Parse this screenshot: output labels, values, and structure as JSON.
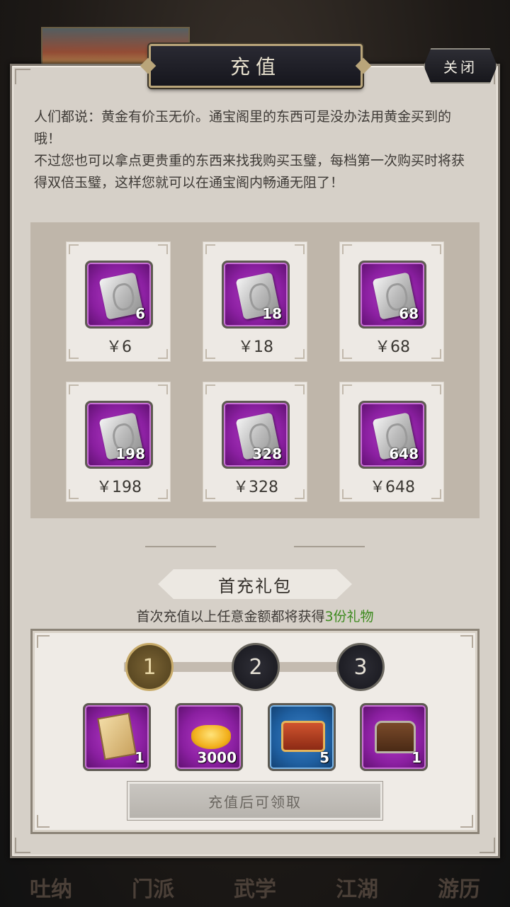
{
  "header": {
    "title": "充值",
    "close_label": "关闭"
  },
  "intro": {
    "line1": "人们都说：黄金有价玉无价。通宝阁里的东西可是没办法用黄金买到的哦！",
    "line2": "不过您也可以拿点更贵重的东西来找我购买玉璧，每档第一次购买时将获得双倍玉璧，这样您就可以在通宝阁内畅通无阻了！"
  },
  "packages": [
    {
      "amount": "6",
      "price": "￥6"
    },
    {
      "amount": "18",
      "price": "￥18"
    },
    {
      "amount": "68",
      "price": "￥68"
    },
    {
      "amount": "198",
      "price": "￥198"
    },
    {
      "amount": "328",
      "price": "￥328"
    },
    {
      "amount": "648",
      "price": "￥648"
    }
  ],
  "first_pack": {
    "title": "首充礼包",
    "desc_prefix": "首次充值以上任意金额都将获得",
    "desc_highlight": "3份礼物",
    "highlight_color": "#3d8a1f",
    "steps": [
      "1",
      "2",
      "3"
    ],
    "active_step": 1,
    "rewards": [
      {
        "icon": "book-icon",
        "qty": "1",
        "rarity": "purple"
      },
      {
        "icon": "gold-ingot-icon",
        "qty": "3000",
        "rarity": "purple"
      },
      {
        "icon": "red-box-icon",
        "qty": "5",
        "rarity": "blue"
      },
      {
        "icon": "treasure-chest-icon",
        "qty": "1",
        "rarity": "purple"
      }
    ],
    "claim_label": "充值后可领取"
  },
  "bg_nav": [
    "吐纳",
    "门派",
    "武学",
    "江湖",
    "游历"
  ]
}
